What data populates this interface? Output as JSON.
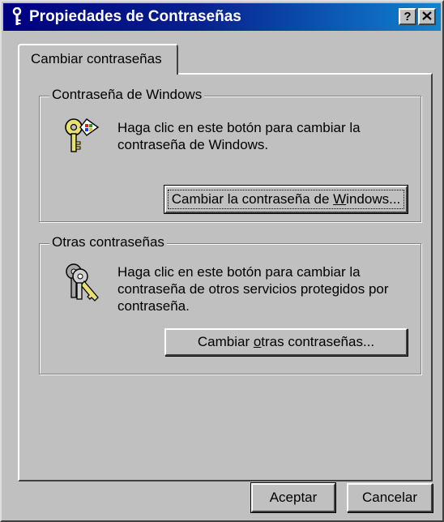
{
  "window": {
    "title": "Propiedades de Contraseñas",
    "help_label": "?",
    "close_label": "✕"
  },
  "tabs": [
    {
      "label": "Cambiar contraseñas"
    }
  ],
  "windows_group": {
    "label": "Contraseña de Windows",
    "text_line1": "Haga clic en este botón para cambiar la",
    "text_line2": "contraseña de Windows.",
    "button": {
      "pre": "Cambiar la contraseña de ",
      "mnemonic": "W",
      "post": "indows..."
    },
    "icon": "windows-key-icon"
  },
  "other_group": {
    "label": "Otras contraseñas",
    "text_line1": "Haga clic en este botón para cambiar la",
    "text_line2": "contraseña de otros servicios protegidos por",
    "text_line3": "contraseña.",
    "button": {
      "pre": "Cambiar ",
      "mnemonic": "o",
      "post": "tras contraseñas..."
    },
    "icon": "keys-icon"
  },
  "footer": {
    "ok_label": "Aceptar",
    "cancel_label": "Cancelar"
  },
  "colors": {
    "face": "#c0c0c0",
    "title_start": "#000080",
    "title_end": "#1084d0"
  }
}
